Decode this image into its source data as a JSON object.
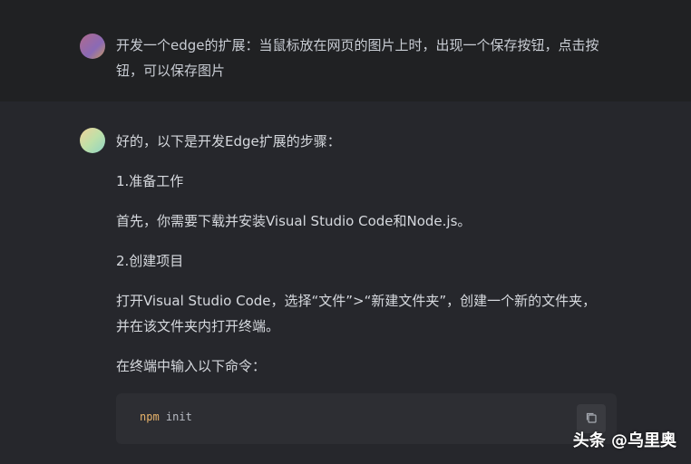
{
  "user_message": {
    "text": "开发一个edge的扩展：当鼠标放在网页的图片上时，出现一个保存按钮，点击按钮，可以保存图片"
  },
  "assistant_message": {
    "intro": "好的，以下是开发Edge扩展的步骤：",
    "step1_title": "1.准备工作",
    "step1_body": "首先，你需要下载并安装Visual Studio Code和Node.js。",
    "step2_title": "2.创建项目",
    "step2_body_line1": "打开Visual Studio Code，选择“文件”>“新建文件夹”，创建一个新的文件夹，",
    "step2_body_line2": "并在该文件夹内打开终端。",
    "terminal_prompt": "在终端中输入以下命令：",
    "code_cmd": "npm",
    "code_args": " init"
  },
  "watermark": "头条 @乌里奥",
  "colors": {
    "background": "#202123",
    "assistant_bg": "#26272c",
    "code_bg": "#2d2e33",
    "code_keyword": "#e8b36a"
  },
  "icons": {
    "copy": "copy-icon"
  }
}
